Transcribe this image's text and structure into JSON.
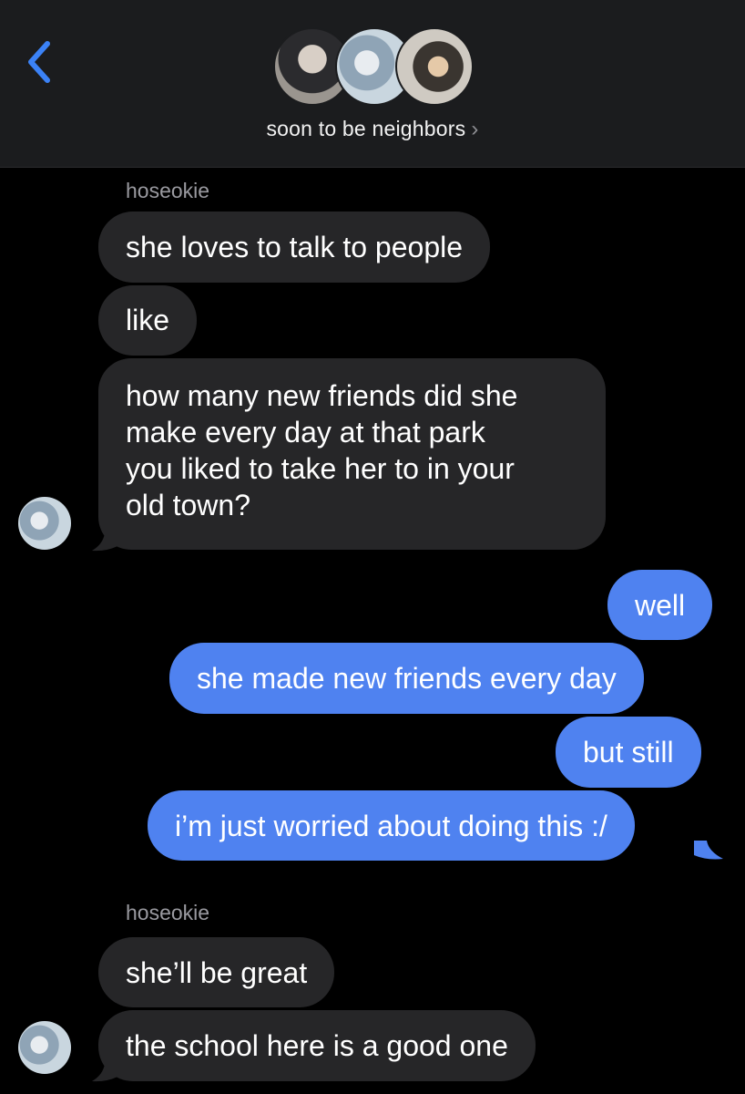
{
  "header": {
    "group_name": "soon to be neighbors",
    "chevron": "›",
    "back_icon": "chevron-left-icon"
  },
  "colors": {
    "header_bg": "#1b1c1e",
    "incoming_bubble": "#262628",
    "outgoing_bubble": "#4f82f0",
    "accent": "#3b82f6",
    "sender_text": "#9a9aa0"
  },
  "messages": [
    {
      "direction": "incoming",
      "sender": "hoseokie"
    },
    {
      "direction": "incoming",
      "text": "she loves to talk to people"
    },
    {
      "direction": "incoming",
      "text": "like"
    },
    {
      "direction": "incoming",
      "lines": [
        "how many new friends did she",
        "make every day at that park",
        "you liked to take her to in your",
        "old town?"
      ]
    },
    {
      "direction": "outgoing",
      "text": "well"
    },
    {
      "direction": "outgoing",
      "text": "she made new friends every day"
    },
    {
      "direction": "outgoing",
      "text": "but still"
    },
    {
      "direction": "outgoing",
      "text": "i’m just worried about doing this :/"
    },
    {
      "direction": "incoming",
      "sender": "hoseokie"
    },
    {
      "direction": "incoming",
      "text": "she’ll be great"
    },
    {
      "direction": "incoming",
      "text": "the school here is a good one"
    }
  ]
}
